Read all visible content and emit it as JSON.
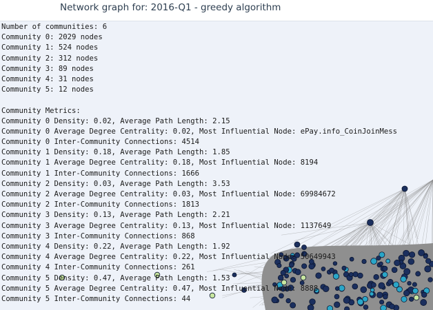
{
  "title": "Network graph for: 2016-Q1 - greedy algorithm",
  "log_lines": [
    "Number of communities: 6",
    "Community 0: 2029 nodes",
    "Community 1: 524 nodes",
    "Community 2: 312 nodes",
    "Community 3: 89 nodes",
    "Community 4: 31 nodes",
    "Community 5: 12 nodes",
    "",
    "Community Metrics:",
    "Community 0 Density: 0.02, Average Path Length: 2.15",
    "Community 0 Average Degree Centrality: 0.02, Most Influential Node: ePay.info_CoinJoinMess",
    "Community 0 Inter-Community Connections: 4514",
    "Community 1 Density: 0.18, Average Path Length: 1.85",
    "Community 1 Average Degree Centrality: 0.18, Most Influential Node: 8194",
    "Community 1 Inter-Community Connections: 1666",
    "Community 2 Density: 0.03, Average Path Length: 3.53",
    "Community 2 Average Degree Centrality: 0.03, Most Influential Node: 69984672",
    "Community 2 Inter-Community Connections: 1813",
    "Community 3 Density: 0.13, Average Path Length: 2.21",
    "Community 3 Average Degree Centrality: 0.13, Most Influential Node: 1137649",
    "Community 3 Inter-Community Connections: 868",
    "Community 4 Density: 0.22, Average Path Length: 1.92",
    "Community 4 Average Degree Centrality: 0.22, Most Influential Node: 50649943",
    "Community 4 Inter-Community Connections: 261",
    "Community 5 Density: 0.47, Average Path Length: 1.53",
    "Community 5 Average Degree Centrality: 0.47, Most Influential Node: 8888",
    "Community 5 Inter-Community Connections: 44"
  ],
  "colors": {
    "background": "#eef2f9",
    "node_dark": "#1b2f5e",
    "node_cyan": "#2aa6c8",
    "node_light": "#c8e6a0",
    "edge": "#8a8a8a"
  }
}
